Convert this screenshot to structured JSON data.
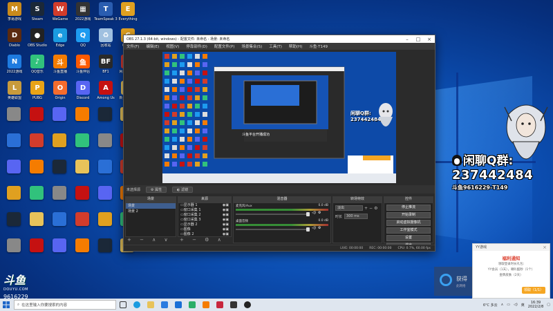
{
  "desktop_icons": [
    {
      "label": "李易游戏",
      "color": "#c98a1b",
      "glyph": "M"
    },
    {
      "label": "Steam",
      "color": "#1b2838",
      "glyph": "S"
    },
    {
      "label": "WeGame",
      "color": "#d23c2b",
      "glyph": "W"
    },
    {
      "label": "2022游戏",
      "color": "#333",
      "glyph": "▦"
    },
    {
      "label": "TeamSpeak 3",
      "color": "#2a5db0",
      "glyph": "T"
    },
    {
      "label": "Everything",
      "color": "#e0a020",
      "glyph": "E"
    },
    {
      "label": "Diablo",
      "color": "#5a2a10",
      "glyph": "D"
    },
    {
      "label": "OBS Studio",
      "color": "#222",
      "glyph": "●"
    },
    {
      "label": "Edge",
      "color": "#1a9be0",
      "glyph": "e"
    },
    {
      "label": "QQ",
      "color": "#1d9bf0",
      "glyph": "Q"
    },
    {
      "label": "回收站",
      "color": "#a0c0e0",
      "glyph": "♻"
    },
    {
      "label": "CS:GO",
      "color": "#e0a020",
      "glyph": "C"
    },
    {
      "label": "2022游戏",
      "color": "#1e7be0",
      "glyph": "N"
    },
    {
      "label": "QQ音乐",
      "color": "#31c27c",
      "glyph": "♪"
    },
    {
      "label": "斗鱼直播",
      "color": "#f57c00",
      "glyph": "斗"
    },
    {
      "label": "斗鱼伴侣",
      "color": "#ff5a00",
      "glyph": "鱼"
    },
    {
      "label": "BF1",
      "color": "#2a2a2a",
      "glyph": "BF"
    },
    {
      "label": "网易云音乐",
      "color": "#d33a31",
      "glyph": "♫"
    },
    {
      "label": "英雄联盟",
      "color": "#c89b3c",
      "glyph": "L"
    },
    {
      "label": "PUBG",
      "color": "#e8a317",
      "glyph": "P"
    },
    {
      "label": "Origin",
      "color": "#f56c2d",
      "glyph": "O"
    },
    {
      "label": "Discord",
      "color": "#5865f2",
      "glyph": "D"
    },
    {
      "label": "Among Us",
      "color": "#c51111",
      "glyph": "A"
    },
    {
      "label": "新建文件夹",
      "color": "#e8c35a",
      "glyph": "▭"
    }
  ],
  "obs": {
    "title": "OBS 27.1.3 (64-bit, windows) - 配置文件: 未命名 - 场景: 未命名",
    "menu": [
      "文件(F)",
      "编辑(E)",
      "视图(V)",
      "停靠部件(D)",
      "配置文件(P)",
      "场景集合(S)",
      "工具(T)",
      "帮助(H)",
      "斗鱼·T149"
    ],
    "scene_bar_left": "未选择源",
    "scene_bar_btn1": "属性",
    "scene_bar_btn2": "滤镜",
    "docks": {
      "scenes": "场景",
      "sources": "来源",
      "mixer": "混音器",
      "transitions": "转场特效",
      "controls": "控件"
    },
    "scenes_list": [
      "场景",
      "场景 2"
    ],
    "sources_list": [
      "显示器 1",
      "窗口采集 1",
      "窗口采集 2",
      "窗口采集 3",
      "显示器 2",
      "图像",
      "图像 2"
    ],
    "mixer_tracks": [
      {
        "name": "麦克风/Aux",
        "db": "0.0 dB"
      },
      {
        "name": "桌面音频",
        "db": "0.0 dB"
      }
    ],
    "transition": {
      "type": "淡出",
      "duration_label": "时长",
      "duration": "300 ms"
    },
    "controls": [
      "停止推流",
      "开始录制",
      "启动虚拟摄像机",
      "工作室模式",
      "设置",
      "退出"
    ],
    "status": {
      "live": "LIVE: 00:00:00",
      "rec": "REC: 00:00:00",
      "cpu": "CPU: 0.7%, 60.00 fps"
    },
    "preview_toast": "斗鱼平台开播成功"
  },
  "overlay": {
    "qq_group_label": "闲聊Q群:",
    "qq_group_number": "237442484",
    "douyu_id": "斗鱼9616229-T149"
  },
  "notification": {
    "header": "YY游戏",
    "title": "福利通知",
    "lines": [
      "领取登录时长礼包:",
      "YY会员（1天），喇叭酷秒（1个）",
      "金牌皮肤（2天）"
    ],
    "button": "领取（1/1）",
    "close": "×"
  },
  "toast": {
    "text": "获得",
    "sub": "此网络"
  },
  "douyu_watermark": {
    "logo": "斗鱼",
    "site": "DOUYU.COM",
    "room": "9616229"
  },
  "taskbar": {
    "search_placeholder": "在这里输入你要搜索的内容",
    "weather": "6°C 多云",
    "time": "16:39",
    "date": "2022/2/8",
    "lang": "英"
  },
  "colors": {
    "accent": "#1d6fd6",
    "obs_bg": "#2b2b2b",
    "notif_orange": "#f5a623"
  }
}
